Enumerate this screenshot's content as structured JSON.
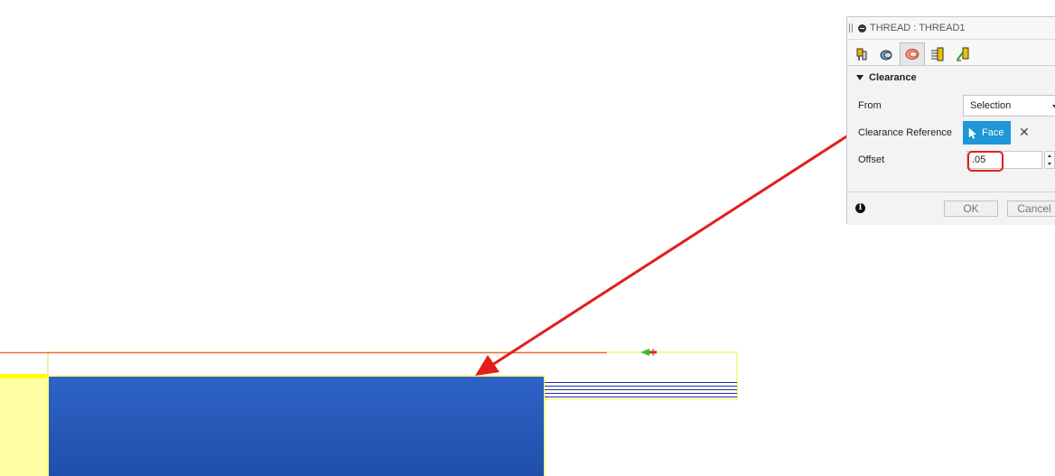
{
  "dialog": {
    "title": "THREAD : THREAD1",
    "tabs": [
      {
        "icon": "tool-tab-icon"
      },
      {
        "icon": "geometry-tab-icon"
      },
      {
        "icon": "clearance-tab-icon",
        "active": true
      },
      {
        "icon": "passes-tab-icon"
      },
      {
        "icon": "linking-tab-icon"
      }
    ],
    "section_title": "Clearance",
    "from_label": "From",
    "from_value": "Selection",
    "clearance_ref_label": "Clearance Reference",
    "face_button_label": "Face",
    "offset_label": "Offset",
    "offset_value": ".05",
    "ok_label": "OK",
    "cancel_label": "Cancel"
  },
  "colors": {
    "part": "#2152b2",
    "stock": "#ffffa6",
    "annotation_arrow": "#e41e1e",
    "face_button": "#1e96d7"
  }
}
